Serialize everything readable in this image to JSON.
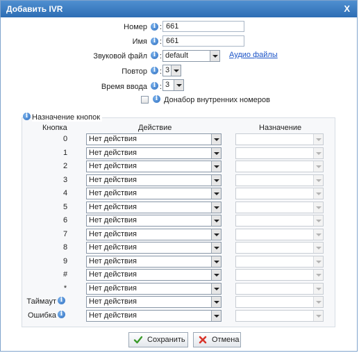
{
  "dialog": {
    "title": "Добавить IVR",
    "close_label": "X"
  },
  "form": {
    "number_label": "Номер",
    "number_value": "661",
    "name_label": "Имя",
    "name_value": "661",
    "sound_label": "Звуковой файл",
    "sound_value": "default",
    "audio_link": "Аудио файлы",
    "repeat_label": "Повтор",
    "repeat_value": "3",
    "input_time_label": "Время ввода",
    "input_time_value": "3",
    "dial_ext_label": "Донабор внутренних номеров",
    "colon": ":"
  },
  "keys_section": {
    "legend": "Назначение кнопок",
    "col_key": "Кнопка",
    "col_action": "Действие",
    "col_dest": "Назначение",
    "rows": [
      {
        "key": "0",
        "action": "Нет действия"
      },
      {
        "key": "1",
        "action": "Нет действия"
      },
      {
        "key": "2",
        "action": "Нет действия"
      },
      {
        "key": "3",
        "action": "Нет действия"
      },
      {
        "key": "4",
        "action": "Нет действия"
      },
      {
        "key": "5",
        "action": "Нет действия"
      },
      {
        "key": "6",
        "action": "Нет действия"
      },
      {
        "key": "7",
        "action": "Нет действия"
      },
      {
        "key": "8",
        "action": "Нет действия"
      },
      {
        "key": "9",
        "action": "Нет действия"
      },
      {
        "key": "#",
        "action": "Нет действия"
      },
      {
        "key": "*",
        "action": "Нет действия"
      },
      {
        "key": "Таймаут",
        "action": "Нет действия"
      },
      {
        "key": "Ошибка",
        "action": "Нет действия"
      }
    ]
  },
  "buttons": {
    "save": "Сохранить",
    "cancel": "Отмена"
  },
  "icons": {
    "info": "info-icon",
    "save": "checkmark-icon",
    "cancel": "x-icon"
  },
  "colors": {
    "title_bar": "#2d6db4",
    "link": "#1a53c7",
    "save_icon": "#3a9a2a",
    "cancel_icon": "#d8352a"
  }
}
